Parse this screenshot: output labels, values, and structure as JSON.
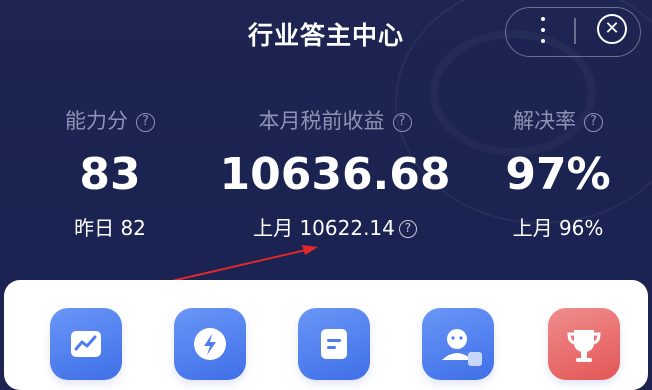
{
  "header": {
    "title": "行业答主中心",
    "more_icon": "more-vertical-icon",
    "close_icon": "close-circle-icon"
  },
  "stats": [
    {
      "label": "能力分",
      "value": "83",
      "sub": "昨日 82"
    },
    {
      "label": "本月税前收益",
      "value": "10636.68",
      "sub": "上月 10622.14"
    },
    {
      "label": "解决率",
      "value": "97%",
      "sub": "上月 96%"
    }
  ],
  "help_glyph": "?",
  "close_glyph": "✕",
  "tools": [
    {
      "icon": "trend-chart-icon",
      "color": "#4f7df0"
    },
    {
      "icon": "lightning-icon",
      "color": "#4f7df0"
    },
    {
      "icon": "document-icon",
      "color": "#4f7df0"
    },
    {
      "icon": "user-chat-icon",
      "color": "#4f7df0"
    },
    {
      "icon": "trophy-icon",
      "color": "#e35656"
    }
  ]
}
